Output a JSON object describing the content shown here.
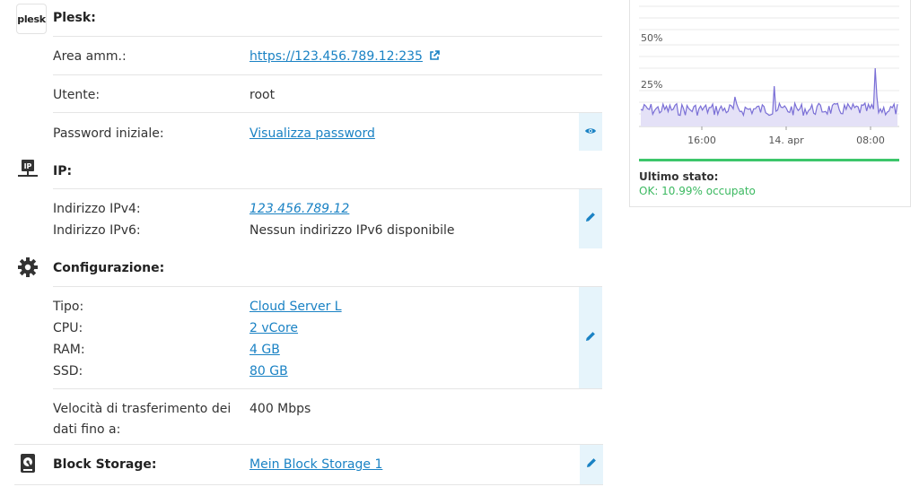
{
  "plesk": {
    "logo_text": "plesk",
    "title": "Plesk:",
    "admin_label": "Area amm.:",
    "admin_url": "https://123.456.789.12:235",
    "user_label": "Utente:",
    "user_value": "root",
    "password_label": "Password iniziale:",
    "password_link": "Visualizza password",
    "icons": [
      "external-link-icon",
      "eye-icon"
    ]
  },
  "ip": {
    "title": "IP:",
    "ipv4_label": "Indirizzo IPv4:",
    "ipv4_value": "123.456.789.12",
    "ipv6_label": "Indirizzo IPv6:",
    "ipv6_value": "Nessun indirizzo IPv6 disponibile",
    "icons": [
      "network-icon",
      "pencil-icon"
    ]
  },
  "config": {
    "title": "Configurazione:",
    "type_label": "Tipo:",
    "type_value": "Cloud Server L",
    "cpu_label": "CPU:",
    "cpu_value": "2 vCore",
    "ram_label": "RAM:",
    "ram_value": "4 GB",
    "ssd_label": "SSD:",
    "ssd_value": "80 GB",
    "transfer_label_1": "Velocità di trasferimento dei",
    "transfer_label_2": "dati fino a:",
    "transfer_value": "400 Mbps",
    "icons": [
      "gear-icon",
      "pencil-icon"
    ]
  },
  "block_storage": {
    "title": "Block Storage:",
    "value": "Mein Block Storage 1",
    "icons": [
      "hard-drive-icon",
      "pencil-icon"
    ]
  },
  "chart": {
    "y_ticks": [
      "50%",
      "25%"
    ],
    "x_ticks": [
      "16:00",
      "14. apr",
      "08:00"
    ],
    "line_color": "#7a6fd6",
    "fill_color": "#e4e1f7"
  },
  "status": {
    "label": "Ultimo stato:",
    "value": "OK: 10.99% occupato",
    "color": "#3cb961"
  }
}
